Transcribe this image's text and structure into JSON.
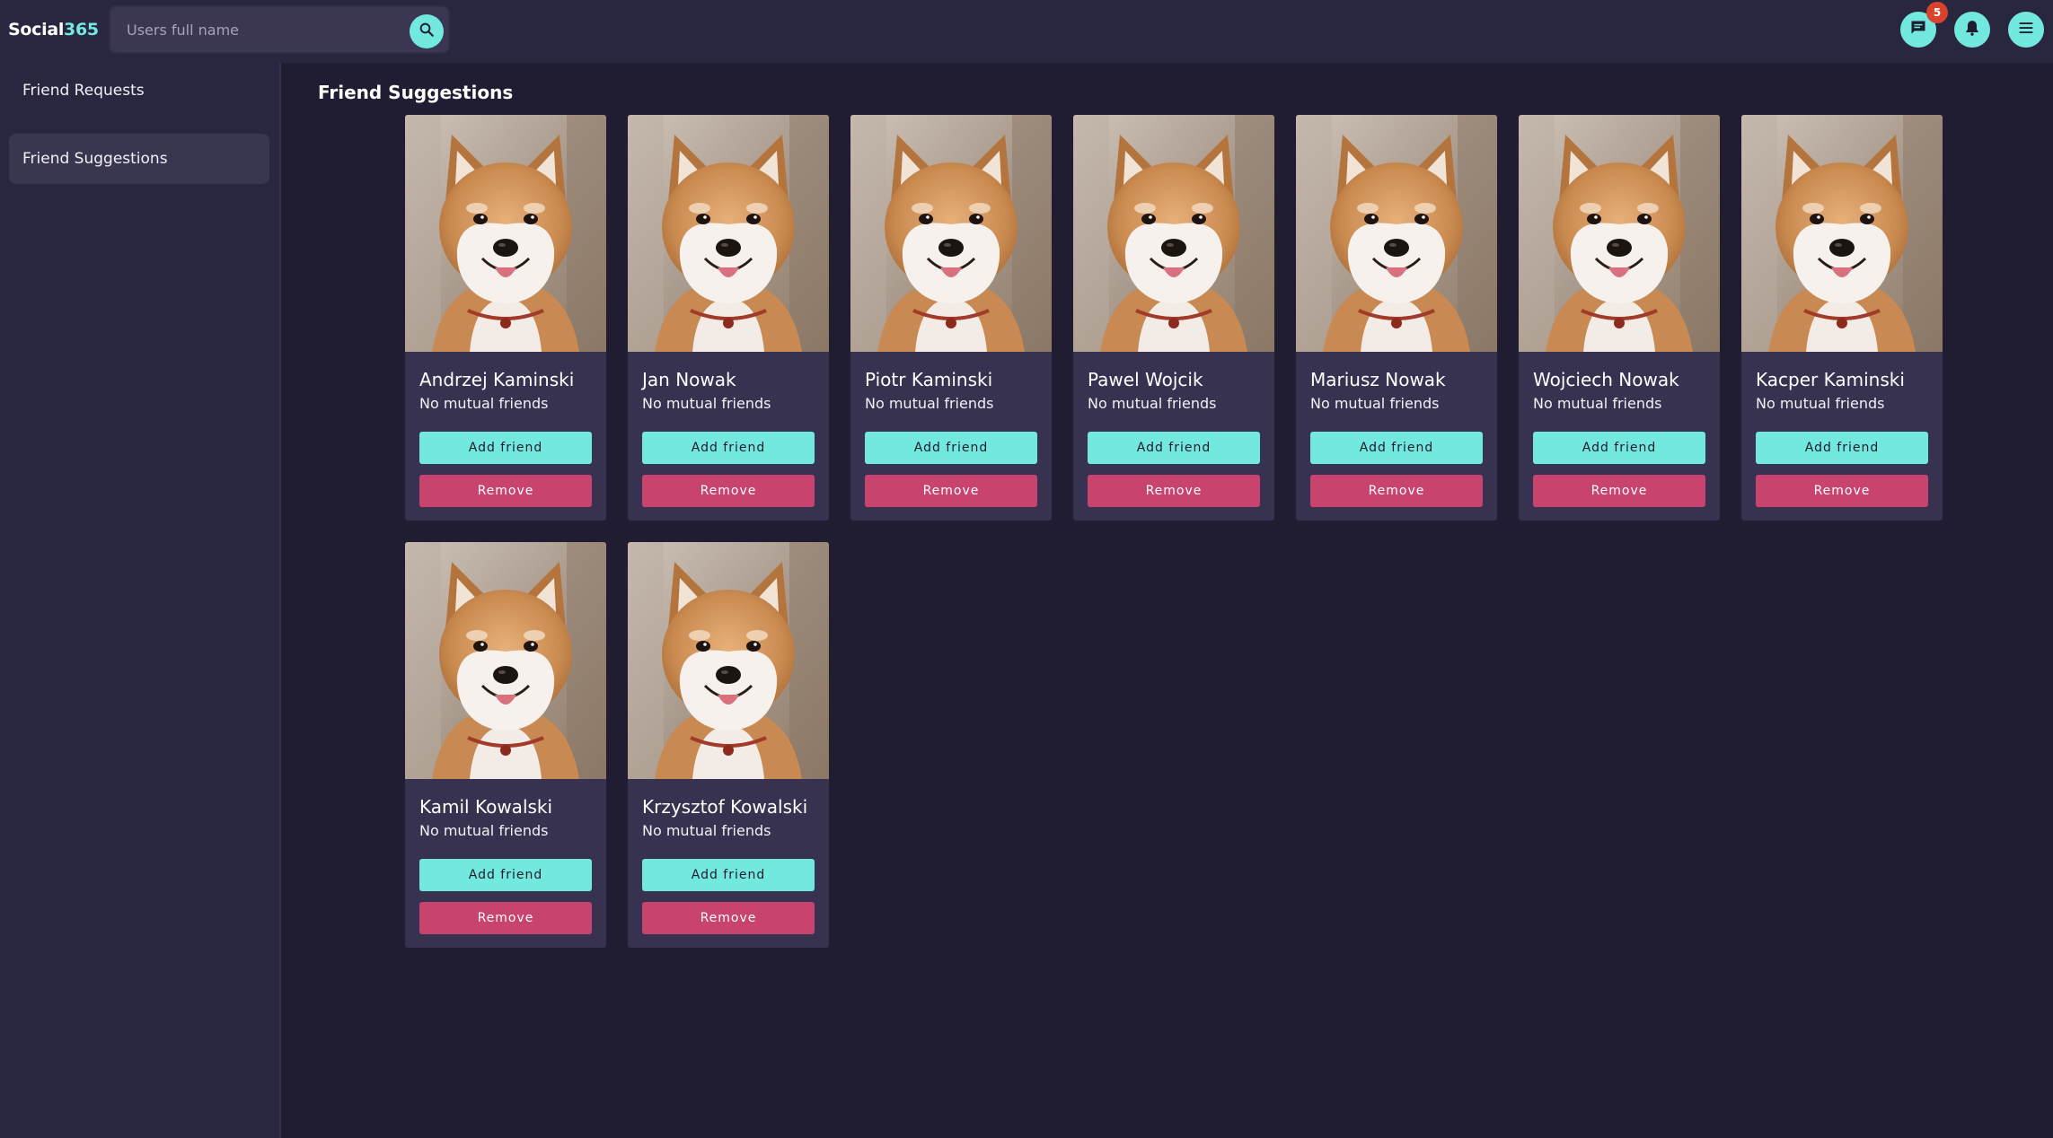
{
  "header": {
    "brand_main": "Social",
    "brand_accent": "365",
    "search_placeholder": "Users full name",
    "messages_badge": "5",
    "colors": {
      "accent": "#72e8df",
      "badge": "#d7432c",
      "background": "#201d33"
    },
    "icons": [
      "search-icon",
      "chat-icon",
      "bell-icon",
      "menu-icon"
    ]
  },
  "sidebar": {
    "items": [
      {
        "label": "Friend Requests",
        "active": false
      },
      {
        "label": "Friend Suggestions",
        "active": true
      }
    ]
  },
  "main": {
    "title": "Friend Suggestions",
    "add_label": "Add friend",
    "remove_label": "Remove",
    "cards": [
      {
        "name": "Andrzej Kaminski",
        "mutual": "No mutual friends"
      },
      {
        "name": "Jan Nowak",
        "mutual": "No mutual friends"
      },
      {
        "name": "Piotr Kaminski",
        "mutual": "No mutual friends"
      },
      {
        "name": "Pawel Wojcik",
        "mutual": "No mutual friends"
      },
      {
        "name": "Mariusz Nowak",
        "mutual": "No mutual friends"
      },
      {
        "name": "Wojciech Nowak",
        "mutual": "No mutual friends"
      },
      {
        "name": "Kacper Kaminski",
        "mutual": "No mutual friends"
      },
      {
        "name": "Kamil Kowalski",
        "mutual": "No mutual friends"
      },
      {
        "name": "Krzysztof Kowalski",
        "mutual": "No mutual friends"
      }
    ]
  }
}
